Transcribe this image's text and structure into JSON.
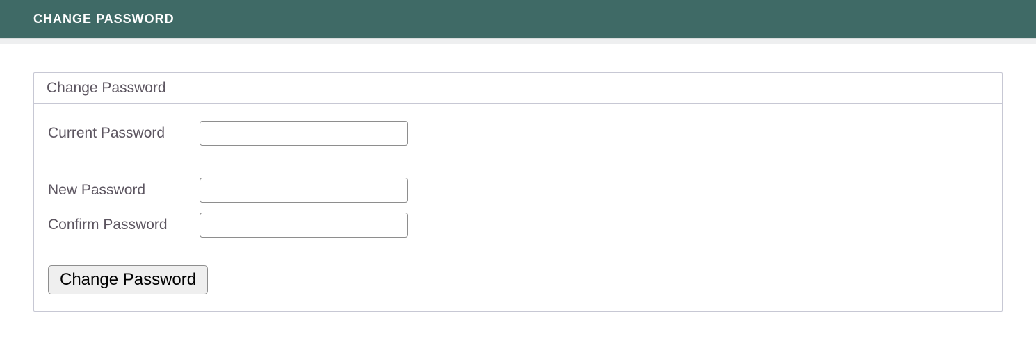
{
  "header": {
    "title": "CHANGE PASSWORD"
  },
  "panel": {
    "title": "Change Password"
  },
  "form": {
    "current_password": {
      "label": "Current Password",
      "value": ""
    },
    "new_password": {
      "label": "New Password",
      "value": ""
    },
    "confirm_password": {
      "label": "Confirm Password",
      "value": ""
    },
    "submit_label": "Change Password"
  }
}
